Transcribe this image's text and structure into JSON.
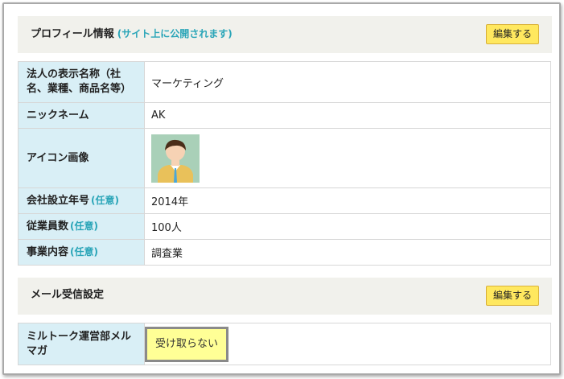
{
  "profile": {
    "title": "プロフィール情報",
    "note": "(サイト上に公開されます)",
    "edit_label": "編集する",
    "rows": [
      {
        "label": "法人の表示名称（社名、業種、商品名等）",
        "optional": "",
        "value": "マーケティング"
      },
      {
        "label": "ニックネーム",
        "optional": "",
        "value": "AK"
      },
      {
        "label": "アイコン画像",
        "optional": "",
        "value": ""
      },
      {
        "label": "会社設立年号",
        "optional": "(任意)",
        "value": "2014年"
      },
      {
        "label": "従業員数",
        "optional": "(任意)",
        "value": "100人"
      },
      {
        "label": "事業内容",
        "optional": "(任意)",
        "value": "調査業"
      }
    ]
  },
  "mail": {
    "title": "メール受信設定",
    "edit_label": "編集する",
    "row_label": "ミルトーク運営部メルマガ",
    "toggle_value": "受け取らない"
  },
  "colors": {
    "accent": "#2aa5b8",
    "button": "#ffe85f",
    "label_bg": "#d9eff6",
    "header_bg": "#f1f1ec"
  },
  "icons": {
    "avatar": "person-avatar-icon"
  }
}
